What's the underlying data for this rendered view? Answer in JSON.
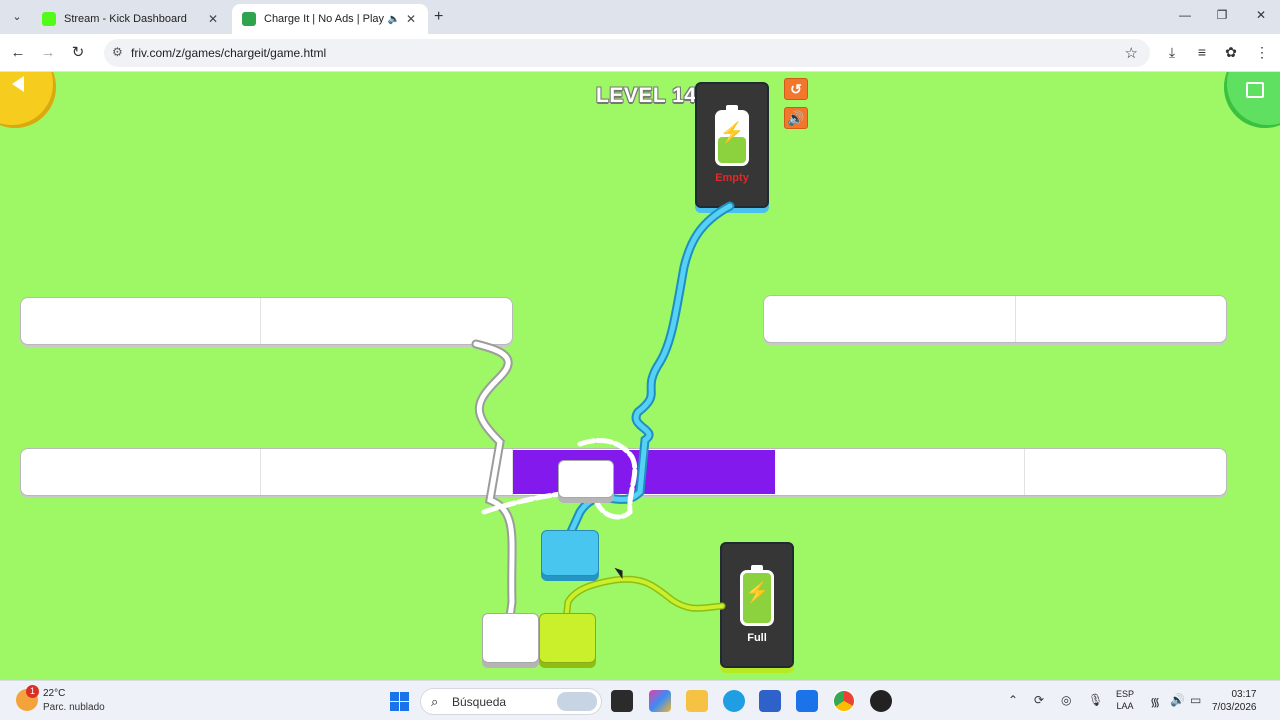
{
  "browser": {
    "tabs": [
      {
        "title": "Stream - Kick Dashboard",
        "favicon_color": "#53fc18"
      },
      {
        "title": "Charge It | No Ads | Play At",
        "favicon_color": "#2ea44f"
      }
    ],
    "url": "friv.com/z/games/chargeit/game.html"
  },
  "game": {
    "level_label": "LEVEL 14",
    "top_station_label": "Empty",
    "bottom_station_label": "Full",
    "colors": {
      "background": "#9ef765",
      "charger": "#8419ee",
      "blue_wire": "#48c6f0",
      "lime_wire": "#c9f02a",
      "white_wire": "#ffffff"
    }
  },
  "taskbar": {
    "weather_badge": "1",
    "temperature": "22°C",
    "condition": "Parc. nublado",
    "search_placeholder": "Búsqueda",
    "language": "ESP",
    "layout": "LAA",
    "time": "03:17",
    "date": "7/03/2026"
  }
}
